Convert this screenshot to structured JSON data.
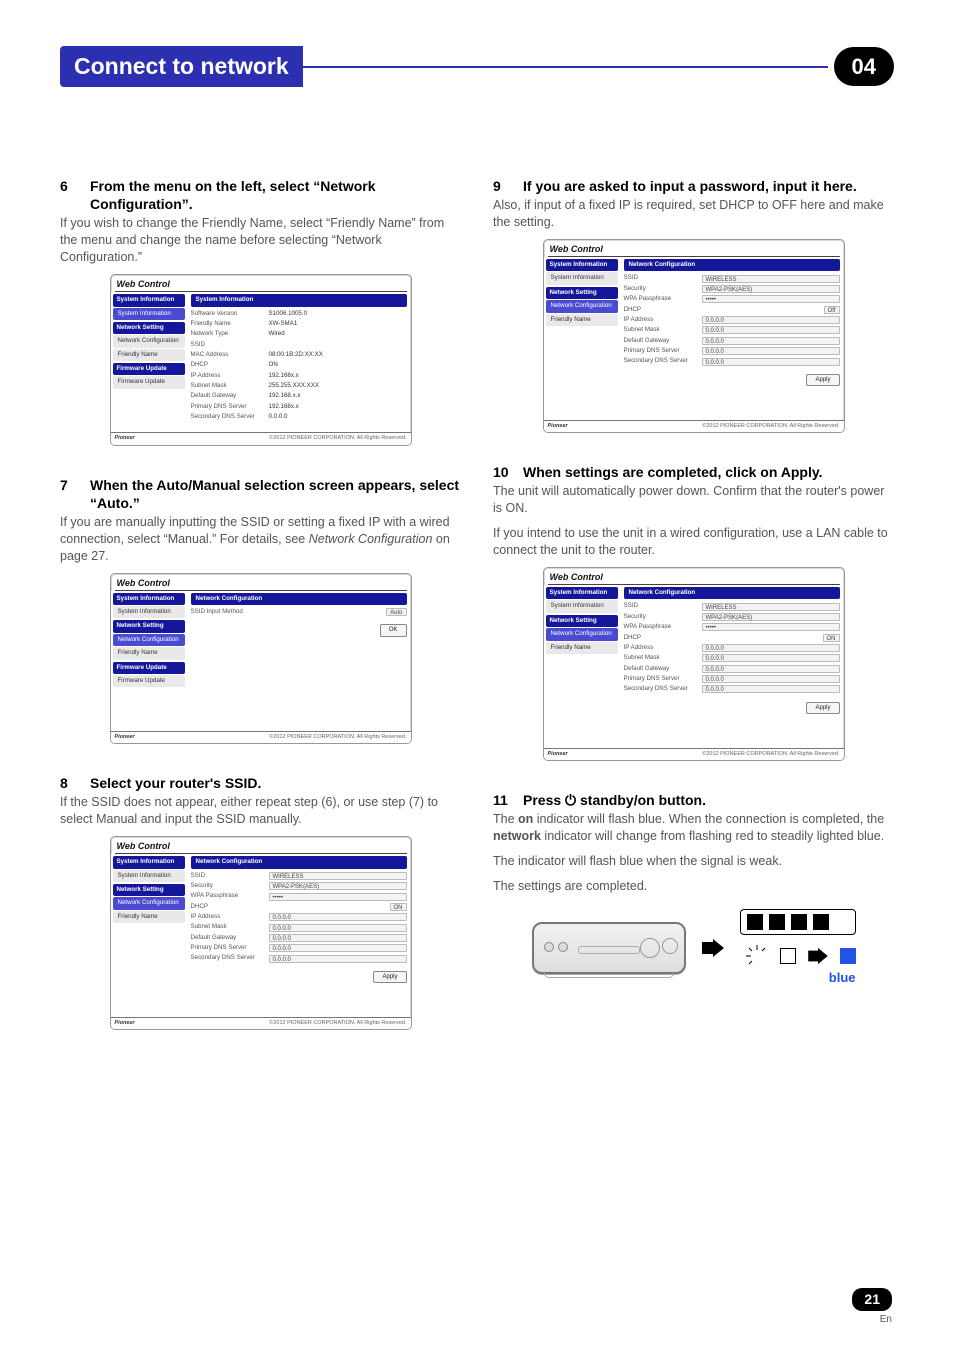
{
  "chapter": {
    "title": "Connect to network",
    "number": "04"
  },
  "left": {
    "step6": {
      "num": "6",
      "heading": "From the menu on the left, select “Network Configuration”.",
      "body": "If you wish to change the Friendly Name, select “Friendly Name” from the menu and change the name before selecting “Network Configuration.”"
    },
    "step7": {
      "num": "7",
      "heading": "When the Auto/Manual selection screen appears, select “Auto.”",
      "body_pre": "If you are manually inputting the SSID or setting a fixed IP with a wired connection, select “Manual.” For details, see ",
      "body_em": "Network Configuration",
      "body_post": " on page 27."
    },
    "step8": {
      "num": "8",
      "heading": "Select your router's SSID.",
      "body": "If the SSID does not appear, either repeat step (6), or use step (7) to select Manual and input the SSID manually."
    }
  },
  "right": {
    "step9": {
      "num": "9",
      "heading": "If you are asked to input a password, input it here.",
      "body": "Also, if input of a fixed IP is required, set DHCP to OFF here and make the setting."
    },
    "step10": {
      "num": "10",
      "heading": "When settings are completed, click on Apply.",
      "body1": "The unit will automatically power down. Confirm that the router's power is ON.",
      "body2": "If you intend to use the unit in a wired configuration, use a LAN cable to connect the unit to the router."
    },
    "step11": {
      "num": "11",
      "heading_pre": "Press ",
      "heading_mid": " standby/on button.",
      "body1_pre": "The ",
      "body1_b1": "on",
      "body1_mid": " indicator will flash blue. When the connection is completed, the ",
      "body1_b2": "network",
      "body1_post": " indicator will change from flashing red to steadily lighted blue.",
      "body2": "The indicator will flash blue when the signal is weak.",
      "body3": "The settings are completed.",
      "blue_label": "blue"
    }
  },
  "panel_common": {
    "window_title": "Web Control",
    "brand": "Pioneer",
    "copyright": "©2012 PIONEER CORPORATION. All Rights Reserved.",
    "sidebar_groups": {
      "sys_info": "System Information",
      "sys_info_item": "System Information",
      "net_setting": "Network Setting",
      "net_config": "Network Configuration",
      "friendly_name": "Friendly Name",
      "fw_update": "Firmware Update",
      "fw_update_item": "Firmware Update"
    },
    "labels": {
      "sys_info_hdr": "System Information",
      "net_cfg_hdr": "Network Configuration",
      "software_version": "Software Version",
      "friendly_name": "Friendly Name",
      "network_type": "Network Type",
      "ssid": "SSID",
      "ssid_input_method": "SSID Input Method",
      "mac": "MAC Address",
      "dhcp": "DHCP",
      "ip": "IP Address",
      "subnet": "Subnet Mask",
      "gateway": "Default Gateway",
      "dns1": "Primary DNS Server",
      "dns2": "Secondary DNS Server",
      "security": "Security",
      "wpa_pass": "WPA Passphrase",
      "ok_btn": "OK",
      "apply_btn": "Apply",
      "auto_opt": "Auto"
    }
  },
  "panel6_values": {
    "software_version": "S1006.1005.0",
    "friendly_name": "XW-SMA1",
    "network_type": "Wired",
    "mac": "08:00:1B:2D:XX:XX",
    "dhcp": "ON",
    "ip": "192.168x.x",
    "subnet": "255.255.XXX.XXX",
    "gateway": "192.168.x.x",
    "dns1": "192.168x.x",
    "dns2": "0.0.0.0"
  },
  "panel_net_values": {
    "ssid": "WIRELESS",
    "security": "WPA2-PSK(AES)",
    "wpa": "•••••",
    "dhcp_on": "ON",
    "dhcp_off": "Off",
    "ip": "0.0.0.0",
    "mask": "0.0.0.0",
    "gw": "0.0.0.0",
    "dns1": "0.0.0.0",
    "dns2": "0.0.0.0"
  },
  "footer": {
    "page": "21",
    "lang": "En"
  }
}
